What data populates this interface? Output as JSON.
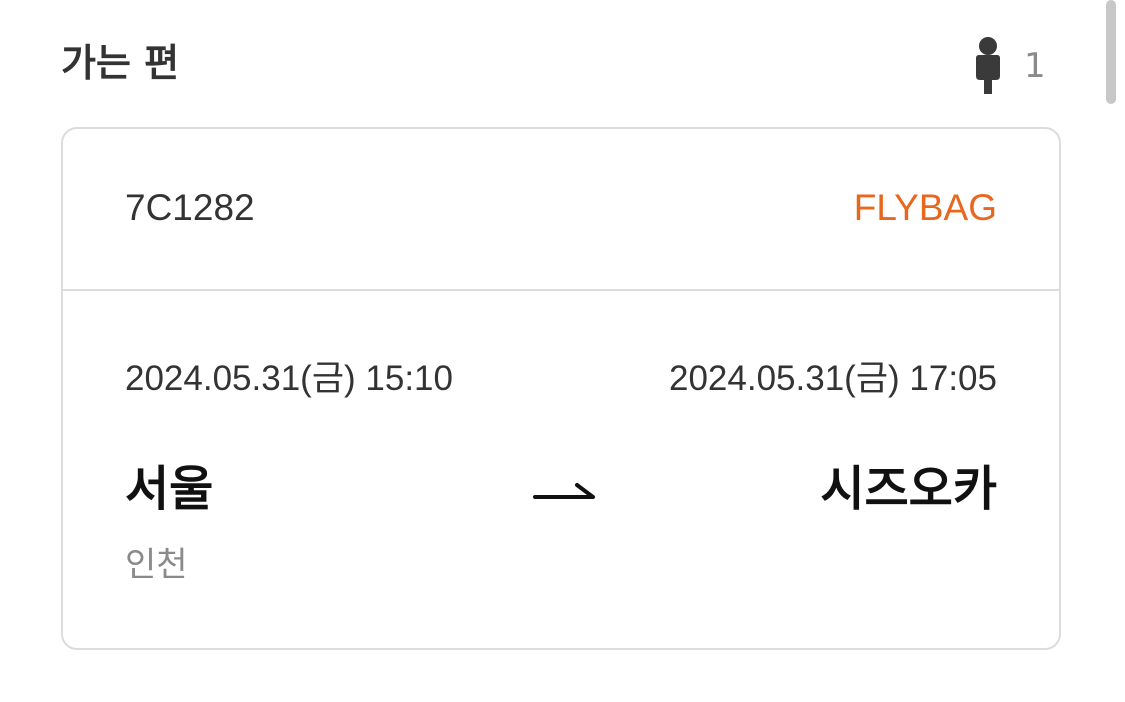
{
  "section": {
    "title": "가는 편",
    "passenger_icon": "person-icon",
    "passenger_count": "1"
  },
  "flight": {
    "number": "7C1282",
    "fare_type": "FLYBAG",
    "departure": {
      "datetime": "2024.05.31(금) 15:10",
      "city": "서울",
      "airport": "인천"
    },
    "arrival": {
      "datetime": "2024.05.31(금) 17:05",
      "city": "시즈오카"
    },
    "route_icon": "arrow-right-icon"
  },
  "colors": {
    "fare_accent": "#e8661e",
    "border": "#dcdcdc",
    "muted_text": "#8a8a8a"
  }
}
